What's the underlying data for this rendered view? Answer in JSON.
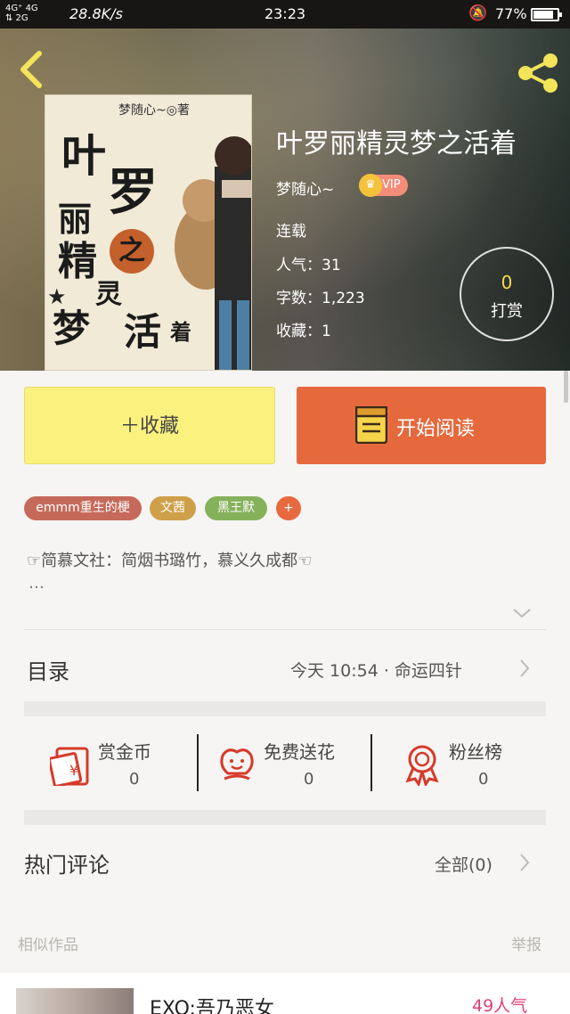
{
  "status_bar": {
    "network_top": "4G⁺ 4G",
    "network_bottom": "⇅ 2G",
    "speed": "28.8K/s",
    "time": "23:23",
    "battery_pct": "77%"
  },
  "cover": {
    "author_line": "梦随心~◎著",
    "chars": [
      "叶",
      "罗",
      "丽",
      "精",
      "之",
      "灵",
      "梦",
      "活",
      "着"
    ]
  },
  "book": {
    "title": "叶罗丽精灵梦之活着",
    "author": "梦随心~",
    "vip_label": "VIP",
    "status": "连载",
    "popularity": "人气：31",
    "word_count": "字数：1,223",
    "favorites": "收藏：1"
  },
  "reward": {
    "count": "0",
    "label": "打赏"
  },
  "actions": {
    "collect_label": "＋收藏",
    "read_label": "开始阅读"
  },
  "tags": [
    {
      "label": "emmm重生的梗",
      "color": "#c56a5a"
    },
    {
      "label": "文茜",
      "color": "#cfa04a"
    },
    {
      "label": "黑王默",
      "color": "#86b15b"
    },
    {
      "label": "+",
      "color": "#e8693f"
    }
  ],
  "intro": {
    "text": "☞简慕文社：简烟书璐竹，慕义久成都☜",
    "more": "…"
  },
  "catalog": {
    "title": "目录",
    "latest": "今天 10:54 · 命运四针"
  },
  "stats": [
    {
      "label": "赏金币",
      "value": "0",
      "icon": "red-envelope-icon"
    },
    {
      "label": "免费送花",
      "value": "0",
      "icon": "flower-icon"
    },
    {
      "label": "粉丝榜",
      "value": "0",
      "icon": "medal-icon"
    }
  ],
  "comments": {
    "title": "热门评论",
    "all_label": "全部(0)"
  },
  "similar": {
    "title": "相似作品",
    "report": "举报",
    "items": [
      {
        "title": "EXO:吾乃恶女",
        "popularity": "49人气"
      }
    ]
  },
  "colors": {
    "accent_orange": "#e5693d",
    "collect_yellow": "#fbf17f",
    "popularity_pink": "#e0417a"
  }
}
